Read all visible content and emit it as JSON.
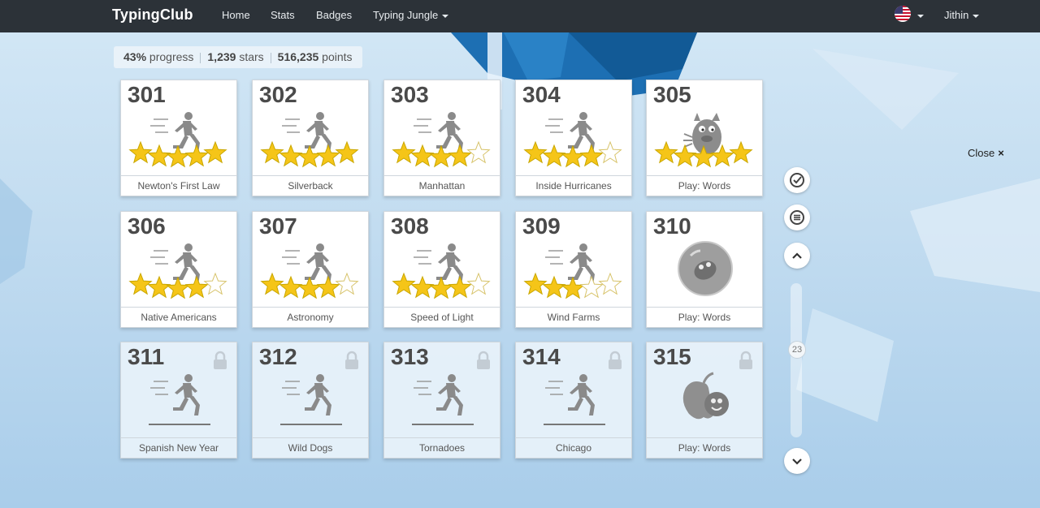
{
  "nav": {
    "brand": "TypingClub",
    "links": [
      "Home",
      "Stats",
      "Badges",
      "Typing Jungle"
    ],
    "user": "Jithin"
  },
  "stats": {
    "progress_value": "43%",
    "progress_label": "progress",
    "stars_value": "1,239",
    "stars_label": "stars",
    "points_value": "516,235",
    "points_label": "points"
  },
  "lessons": [
    {
      "num": "301",
      "title": "Newton's First Law",
      "kind": "runner",
      "stars": 5,
      "locked": false
    },
    {
      "num": "302",
      "title": "Silverback",
      "kind": "runner",
      "stars": 5,
      "locked": false
    },
    {
      "num": "303",
      "title": "Manhattan",
      "kind": "runner",
      "stars": 4,
      "locked": false
    },
    {
      "num": "304",
      "title": "Inside Hurricanes",
      "kind": "runner",
      "stars": 4,
      "locked": false
    },
    {
      "num": "305",
      "title": "Play: Words",
      "kind": "monster",
      "stars": 5,
      "locked": false
    },
    {
      "num": "306",
      "title": "Native Americans",
      "kind": "runner",
      "stars": 4,
      "locked": false
    },
    {
      "num": "307",
      "title": "Astronomy",
      "kind": "runner",
      "stars": 4,
      "locked": false
    },
    {
      "num": "308",
      "title": "Speed of Light",
      "kind": "runner",
      "stars": 4,
      "locked": false
    },
    {
      "num": "309",
      "title": "Wind Farms",
      "kind": "runner",
      "stars": 3,
      "locked": false
    },
    {
      "num": "310",
      "title": "Play: Words",
      "kind": "bubble",
      "stars": 0,
      "locked": false
    },
    {
      "num": "311",
      "title": "Spanish New Year",
      "kind": "runner",
      "stars": 0,
      "locked": true
    },
    {
      "num": "312",
      "title": "Wild Dogs",
      "kind": "runner",
      "stars": 0,
      "locked": true
    },
    {
      "num": "313",
      "title": "Tornadoes",
      "kind": "runner",
      "stars": 0,
      "locked": true
    },
    {
      "num": "314",
      "title": "Chicago",
      "kind": "runner",
      "stars": 0,
      "locked": true
    },
    {
      "num": "315",
      "title": "Play: Words",
      "kind": "apple",
      "stars": 0,
      "locked": true
    }
  ],
  "sidebar": {
    "scroll_value": "23",
    "icons": [
      "check-circle-icon",
      "menu-icon",
      "chevron-up-icon",
      "chevron-down-icon"
    ]
  },
  "close_label": "Close",
  "close_glyph": "×",
  "colors": {
    "navbar": "#2c3238",
    "star": "#f5c518",
    "star_outline": "#c9a700"
  }
}
